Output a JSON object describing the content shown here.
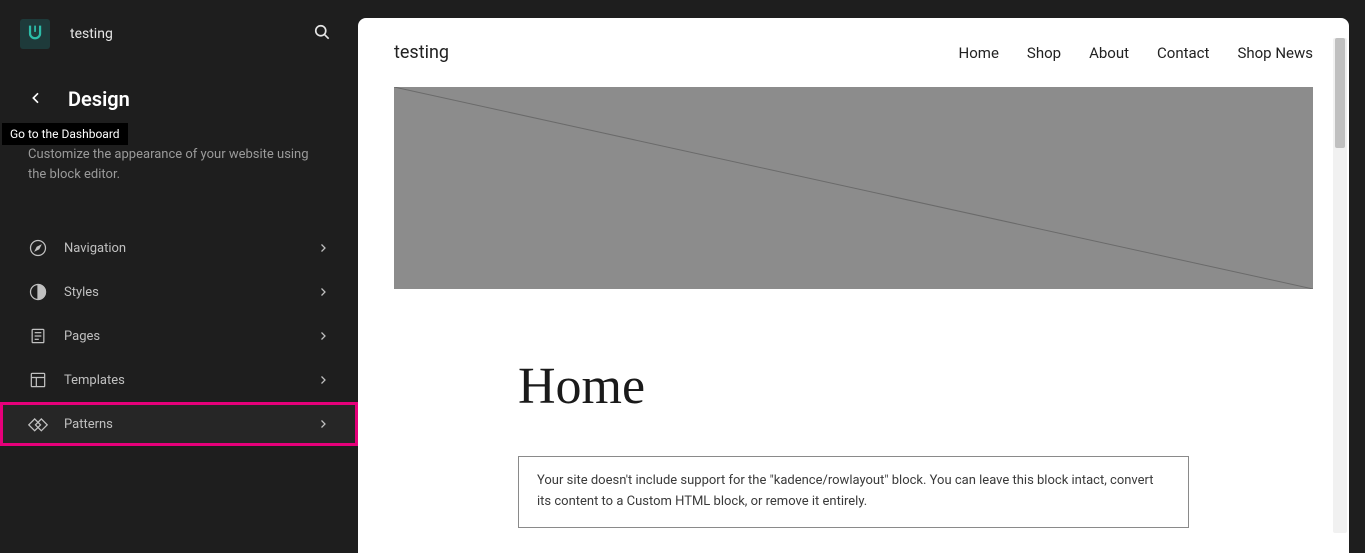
{
  "top": {
    "site_title": "testing",
    "logo_letter": "ᕫ"
  },
  "sidebar": {
    "title": "Design",
    "tooltip": "Go to the Dashboard",
    "description": "Customize the appearance of your website using the block editor.",
    "items": [
      {
        "label": "Navigation"
      },
      {
        "label": "Styles"
      },
      {
        "label": "Pages"
      },
      {
        "label": "Templates"
      },
      {
        "label": "Patterns"
      }
    ]
  },
  "preview": {
    "site_name": "testing",
    "nav": [
      "Home",
      "Shop",
      "About",
      "Contact",
      "Shop News"
    ],
    "page_title": "Home",
    "notice": "Your site doesn't include support for the \"kadence/rowlayout\" block. You can leave this block intact, convert its content to a Custom HTML block, or remove it entirely."
  }
}
